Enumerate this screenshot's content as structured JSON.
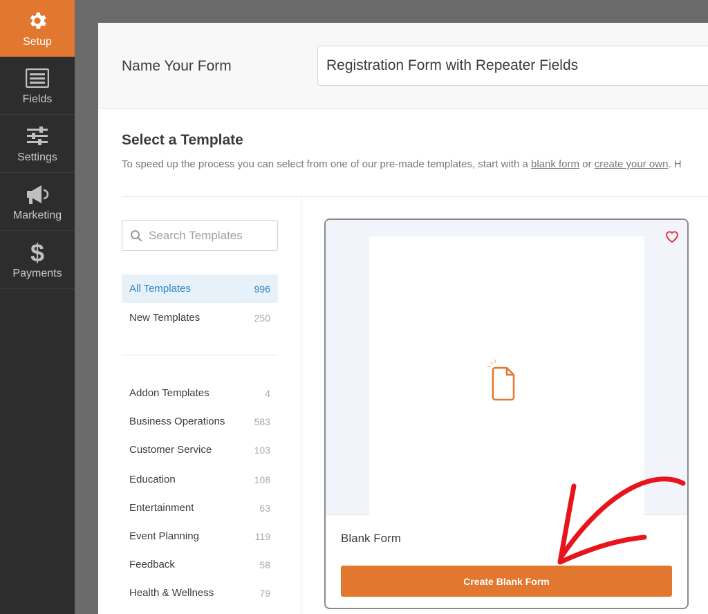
{
  "sidebar": {
    "items": [
      {
        "label": "Setup",
        "icon": "gear-icon",
        "active": true
      },
      {
        "label": "Fields",
        "icon": "fields-list-icon"
      },
      {
        "label": "Settings",
        "icon": "sliders-icon"
      },
      {
        "label": "Marketing",
        "icon": "megaphone-icon"
      },
      {
        "label": "Payments",
        "icon": "dollar-icon"
      }
    ]
  },
  "form_name": {
    "label": "Name Your Form",
    "value": "Registration Form with Repeater Fields"
  },
  "template_section": {
    "title": "Select a Template",
    "description_prefix": "To speed up the process you can select from one of our pre-made templates, start with a ",
    "blank_form_link": "blank form",
    "description_middle": " or ",
    "create_your_own_link": "create your own",
    "description_suffix": ". H"
  },
  "search": {
    "placeholder": "Search Templates"
  },
  "categories_top": [
    {
      "label": "All Templates",
      "count": "996",
      "active": true
    },
    {
      "label": "New Templates",
      "count": "250"
    }
  ],
  "categories": [
    {
      "label": "Addon Templates",
      "count": "4"
    },
    {
      "label": "Business Operations",
      "count": "583"
    },
    {
      "label": "Customer Service",
      "count": "103"
    },
    {
      "label": "Education",
      "count": "108"
    },
    {
      "label": "Entertainment",
      "count": "63"
    },
    {
      "label": "Event Planning",
      "count": "119"
    },
    {
      "label": "Feedback",
      "count": "58"
    },
    {
      "label": "Health & Wellness",
      "count": "79"
    }
  ],
  "card": {
    "name": "Blank Form",
    "button_label": "Create Blank Form"
  },
  "colors": {
    "accent": "#e27730",
    "sidebar_bg": "#2d2d2d",
    "active_category": "#2e86c9",
    "annotation_arrow": "#e8141c"
  }
}
